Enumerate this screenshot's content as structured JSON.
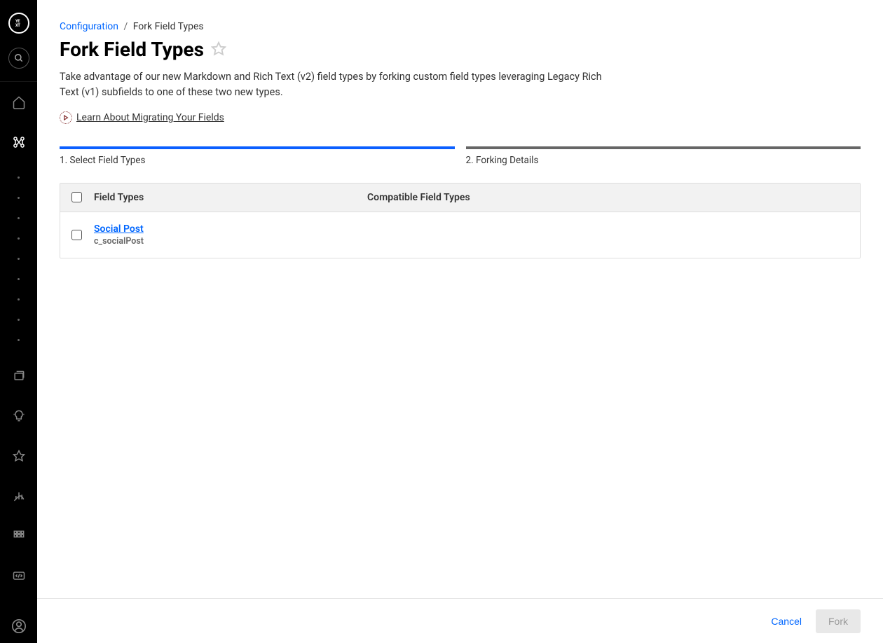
{
  "logo": "YEXT",
  "breadcrumb": {
    "parent": "Configuration",
    "sep": "/",
    "current": "Fork Field Types"
  },
  "page": {
    "title": "Fork Field Types",
    "description": "Take advantage of our new Markdown and Rich Text (v2) field types by forking custom field types leveraging Legacy Rich Text (v1) subfields to one of these two new types."
  },
  "learn_link": "Learn About Migrating Your Fields",
  "steps": [
    {
      "label": "1. Select Field Types",
      "active": true
    },
    {
      "label": "2. Forking Details",
      "active": false
    }
  ],
  "table": {
    "headers": {
      "field_types": "Field Types",
      "compatible": "Compatible Field Types"
    },
    "rows": [
      {
        "name": "Social Post",
        "id": "c_socialPost"
      }
    ]
  },
  "footer": {
    "cancel": "Cancel",
    "fork": "Fork"
  }
}
